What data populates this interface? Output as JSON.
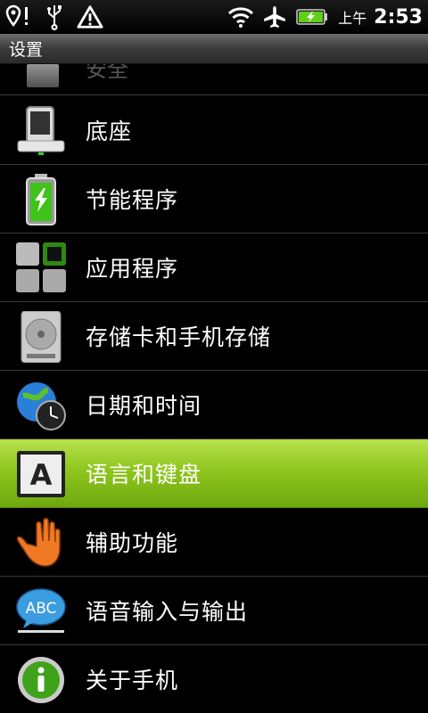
{
  "status_bar": {
    "left_icons": [
      "location-alert-icon",
      "usb-icon",
      "warning-icon"
    ],
    "right_icons": [
      "wifi-icon",
      "airplane-icon",
      "battery-charging-icon"
    ],
    "ampm": "上午",
    "time": "2:53"
  },
  "title": "设置",
  "partial_item": {
    "label": "安全",
    "icon": "security-icon"
  },
  "items": [
    {
      "label": "底座",
      "icon": "dock-icon"
    },
    {
      "label": "节能程序",
      "icon": "battery-saver-icon"
    },
    {
      "label": "应用程序",
      "icon": "applications-icon"
    },
    {
      "label": "存储卡和手机存储",
      "icon": "storage-icon"
    },
    {
      "label": "日期和时间",
      "icon": "date-time-icon"
    },
    {
      "label": "语言和键盘",
      "icon": "keyboard-icon",
      "selected": true
    },
    {
      "label": "辅助功能",
      "icon": "accessibility-icon"
    },
    {
      "label": "语音输入与输出",
      "icon": "voice-io-icon"
    },
    {
      "label": "关于手机",
      "icon": "about-icon"
    }
  ],
  "colors": {
    "highlight": "#8fc61e",
    "divider": "#3a3a3a"
  }
}
